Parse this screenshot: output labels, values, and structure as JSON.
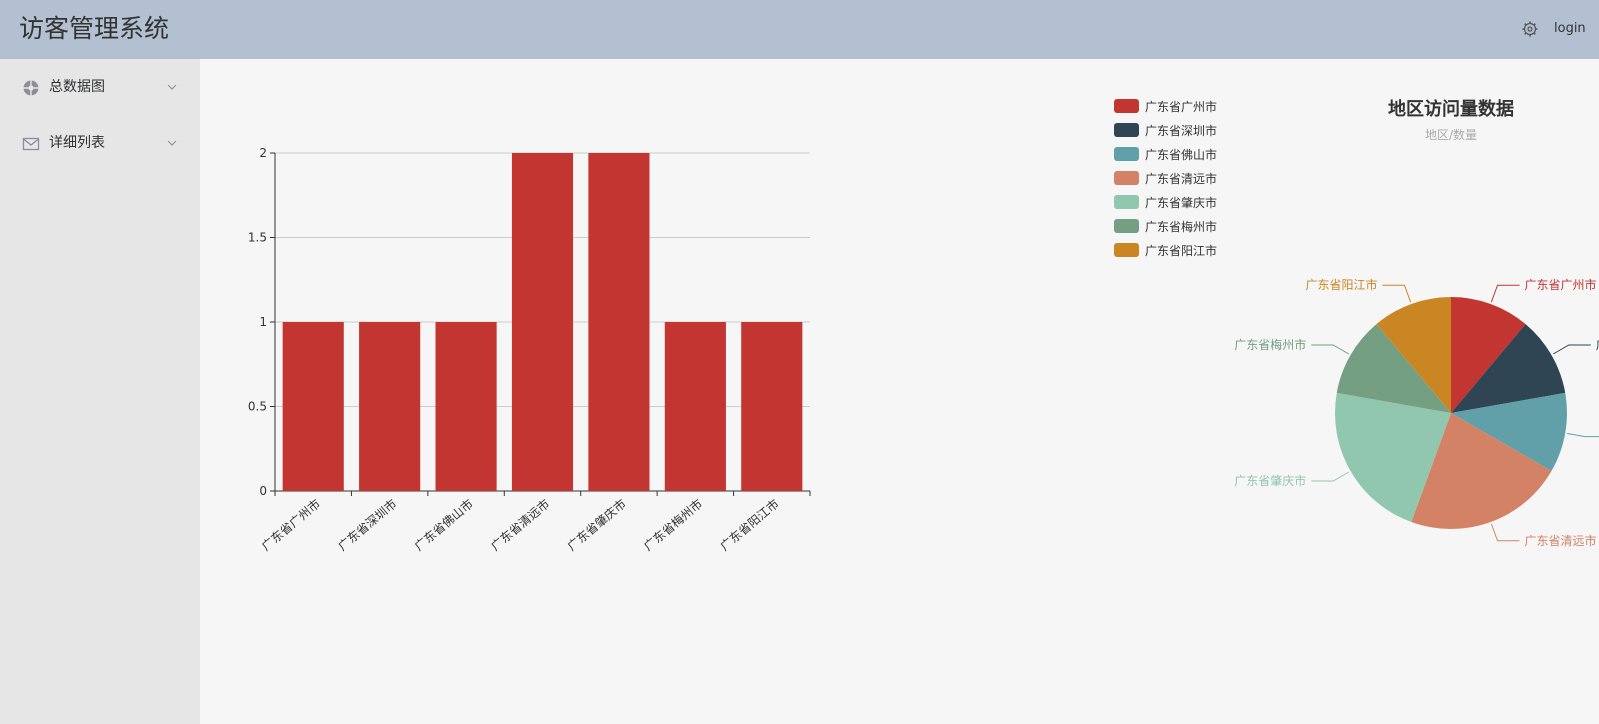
{
  "header": {
    "title": "访客管理系统",
    "login_label": "login",
    "settings_icon": "gear-icon"
  },
  "sidebar": {
    "items": [
      {
        "label": "总数据图",
        "icon": "dashboard-icon"
      },
      {
        "label": "详细列表",
        "icon": "mail-icon"
      }
    ]
  },
  "colors": {
    "header_bg": "#b3c0d1",
    "sidebar_bg": "#e6e6e6",
    "bar": "#c23531",
    "palette": [
      "#c23531",
      "#2f4554",
      "#61a0a8",
      "#d48265",
      "#91c7ae",
      "#749f83",
      "#ca8622"
    ]
  },
  "chart_data": [
    {
      "type": "bar",
      "categories": [
        "广东省广州市",
        "广东省深圳市",
        "广东省佛山市",
        "广东省清远市",
        "广东省肇庆市",
        "广东省梅州市",
        "广东省阳江市"
      ],
      "values": [
        1,
        1,
        1,
        2,
        2,
        1,
        1
      ],
      "yticks": [
        "0",
        "0.5",
        "1",
        "1.5",
        "2"
      ],
      "ylim": [
        0,
        2
      ],
      "grid": true
    },
    {
      "type": "pie",
      "title": "地区访问量数据",
      "subtitle": "地区/数量",
      "legend_position": "left",
      "labels": [
        "广东省广州市",
        "广东省深圳市",
        "广东省佛山市",
        "广东省清远市",
        "广东省肇庆市",
        "广东省梅州市",
        "广东省阳江市"
      ],
      "values": [
        1,
        1,
        1,
        2,
        2,
        1,
        1
      ]
    }
  ]
}
